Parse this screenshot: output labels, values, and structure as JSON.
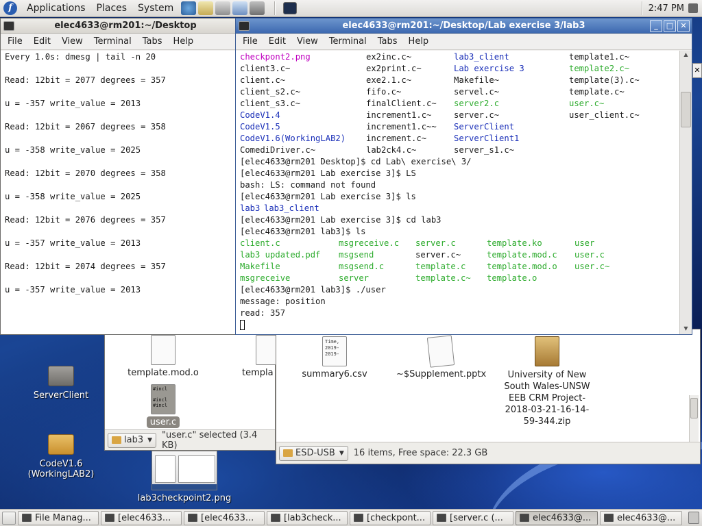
{
  "top_panel": {
    "menus": [
      "Applications",
      "Places",
      "System"
    ],
    "clock": "2:47 PM"
  },
  "term_left": {
    "title": "elec4633@rm201:~/Desktop",
    "menu": [
      "File",
      "Edit",
      "View",
      "Terminal",
      "Tabs",
      "Help"
    ],
    "lines": [
      "Every 1.0s: dmesg | tail -n 20",
      "",
      "Read: 12bit = 2077 degrees = 357",
      "",
      "u = -357 write_value = 2013",
      "",
      "Read: 12bit = 2067 degrees = 358",
      "",
      "u = -358 write_value = 2025",
      "",
      "Read: 12bit = 2070 degrees = 358",
      "",
      "u = -358 write_value = 2025",
      "",
      "Read: 12bit = 2076 degrees = 357",
      "",
      "u = -357 write_value = 2013",
      "",
      "Read: 12bit = 2074 degrees = 357",
      "",
      "u = -357 write_value = 2013"
    ]
  },
  "term_main": {
    "title": "elec4633@rm201:~/Desktop/Lab exercise 3/lab3",
    "menu": [
      "File",
      "Edit",
      "View",
      "Terminal",
      "Tabs",
      "Help"
    ],
    "listing_rows": [
      [
        {
          "t": "checkpont2.png",
          "c": "magenta"
        },
        {
          "t": "ex2inc.c~",
          "c": "default"
        },
        {
          "t": "lab3_client",
          "c": "blue"
        },
        {
          "t": "template1.c~",
          "c": "default"
        }
      ],
      [
        {
          "t": "client3.c~",
          "c": "default"
        },
        {
          "t": "ex2print.c~",
          "c": "default"
        },
        {
          "t": "Lab exercise 3",
          "c": "blue"
        },
        {
          "t": "template2.c~",
          "c": "green"
        }
      ],
      [
        {
          "t": "client.c~",
          "c": "default"
        },
        {
          "t": "exe2.1.c~",
          "c": "default"
        },
        {
          "t": "Makefile~",
          "c": "default"
        },
        {
          "t": "template(3).c~",
          "c": "default"
        }
      ],
      [
        {
          "t": "client_s2.c~",
          "c": "default"
        },
        {
          "t": "fifo.c~",
          "c": "default"
        },
        {
          "t": "servel.c~",
          "c": "default"
        },
        {
          "t": "template.c~",
          "c": "default"
        }
      ],
      [
        {
          "t": "client_s3.c~",
          "c": "default"
        },
        {
          "t": "finalClient.c~",
          "c": "default"
        },
        {
          "t": "server2.c",
          "c": "green"
        },
        {
          "t": "user.c~",
          "c": "green"
        }
      ],
      [
        {
          "t": "CodeV1.4",
          "c": "blue"
        },
        {
          "t": "increment1.c~",
          "c": "default"
        },
        {
          "t": "server.c~",
          "c": "default"
        },
        {
          "t": "user_client.c~",
          "c": "default"
        }
      ],
      [
        {
          "t": "CodeV1.5",
          "c": "blue"
        },
        {
          "t": "increment1.c~~",
          "c": "default"
        },
        {
          "t": "ServerClient",
          "c": "blue"
        },
        {
          "t": "",
          "c": "default"
        }
      ],
      [
        {
          "t": "CodeV1.6(WorkingLAB2)",
          "c": "blue"
        },
        {
          "t": "increment.c~",
          "c": "default"
        },
        {
          "t": "ServerClient1",
          "c": "blue"
        },
        {
          "t": "",
          "c": "default"
        }
      ],
      [
        {
          "t": "ComediDriver.c~",
          "c": "default"
        },
        {
          "t": "lab2ck4.c~",
          "c": "default"
        },
        {
          "t": "server_s1.c~",
          "c": "default"
        },
        {
          "t": "",
          "c": "default"
        }
      ]
    ],
    "cmd_lines_1": [
      "[elec4633@rm201 Desktop]$ cd Lab\\ exercise\\ 3/",
      "[elec4633@rm201 Lab exercise 3]$ LS",
      "bash: LS: command not found",
      "[elec4633@rm201 Lab exercise 3]$ ls"
    ],
    "ls_row": [
      {
        "t": "lab3",
        "c": "blue"
      },
      {
        "t": "lab3_client",
        "c": "blue"
      }
    ],
    "cmd_lines_2": [
      "[elec4633@rm201 Lab exercise 3]$ cd lab3",
      "[elec4633@rm201 lab3]$ ls"
    ],
    "lab3_rows": [
      [
        {
          "t": "client.c",
          "c": "green"
        },
        {
          "t": "msgreceive.c",
          "c": "green"
        },
        {
          "t": "server.c",
          "c": "green"
        },
        {
          "t": "template.ko",
          "c": "green"
        },
        {
          "t": "user",
          "c": "green"
        }
      ],
      [
        {
          "t": "lab3 updated.pdf",
          "c": "green"
        },
        {
          "t": "msgsend",
          "c": "green"
        },
        {
          "t": "server.c~",
          "c": "default"
        },
        {
          "t": "template.mod.c",
          "c": "green"
        },
        {
          "t": "user.c",
          "c": "green"
        }
      ],
      [
        {
          "t": "Makefile",
          "c": "green"
        },
        {
          "t": "msgsend.c",
          "c": "green"
        },
        {
          "t": "template.c",
          "c": "green"
        },
        {
          "t": "template.mod.o",
          "c": "green"
        },
        {
          "t": "user.c~",
          "c": "green"
        }
      ],
      [
        {
          "t": "msgreceive",
          "c": "green"
        },
        {
          "t": "server",
          "c": "green"
        },
        {
          "t": "template.c~",
          "c": "green"
        },
        {
          "t": "template.o",
          "c": "green"
        },
        {
          "t": "",
          "c": "default"
        }
      ]
    ],
    "cmd_lines_3": [
      "[elec4633@rm201 lab3]$ ./user",
      "message: position",
      "read: 357"
    ]
  },
  "fm_left": {
    "items": [
      {
        "label": "template.mod.o"
      },
      {
        "label": "templa"
      },
      {
        "label": "user.c"
      }
    ],
    "file_preview_text": "#incl\n\n#incl\n#incl",
    "location": "lab3",
    "status": "\"user.c\" selected (3.4 KB)"
  },
  "fm_right": {
    "items": [
      {
        "label": "summary6.csv",
        "preview": "Time,\n2019-\n2019-"
      },
      {
        "label": "~$Supplement.pptx"
      },
      {
        "label": "University of New South Wales-UNSW EEB CRM Project-2018-03-21-16-14-59-344.zip"
      }
    ],
    "location": "ESD-USB",
    "status": "16 items, Free space: 22.3 GB"
  },
  "desktop_icons": [
    {
      "label": "ServerClient"
    },
    {
      "label": "CodeV1.6 (WorkingLAB2)"
    },
    {
      "label": "lab3checkpoint2.png"
    }
  ],
  "taskbar": [
    {
      "label": "File Manag...",
      "active": false
    },
    {
      "label": "[elec4633...",
      "active": false
    },
    {
      "label": "[elec4633...",
      "active": false
    },
    {
      "label": "[lab3check...",
      "active": false
    },
    {
      "label": "[checkpont...",
      "active": false
    },
    {
      "label": "[server.c (...",
      "active": false
    },
    {
      "label": "elec4633@...",
      "active": true
    },
    {
      "label": "elec4633@...",
      "active": false
    }
  ],
  "colors": {
    "magenta": "#c000c0",
    "blue": "#1a2fb8",
    "green": "#2cab2c",
    "titlebar_active": "#4a74b8"
  }
}
